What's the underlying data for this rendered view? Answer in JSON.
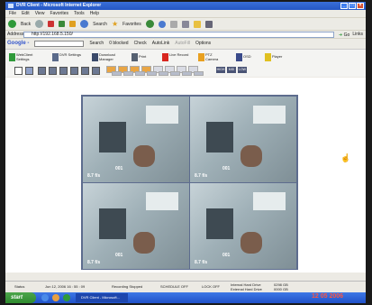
{
  "window": {
    "title": "DVR Client - Microsoft Internet Explorer",
    "controls": [
      "_",
      "□",
      "×"
    ]
  },
  "menu": [
    "File",
    "Edit",
    "View",
    "Favorites",
    "Tools",
    "Help"
  ],
  "ie_toolbar": {
    "back": "Back",
    "search": "Search",
    "favorites": "Favorites"
  },
  "address": {
    "label": "Address",
    "value": "http://192.168.5.150/",
    "go": "Go",
    "links": "Links"
  },
  "google_bar": {
    "logo": "Google -",
    "search": "Search",
    "blocked": "0 blocked",
    "check": "Check",
    "autolink": "AutoLink",
    "autofill": "AutoFill",
    "options": "Options"
  },
  "app_toolbar": [
    {
      "label": "WebClient Settings",
      "color": "#2f9a3a"
    },
    {
      "label": "DVR Settings",
      "color": "#5a6a8a"
    },
    {
      "label": "Download Manager",
      "color": "#3a4a6a"
    },
    {
      "label": "Print",
      "color": "#556070"
    },
    {
      "label": "Live Record",
      "color": "#d8261f"
    },
    {
      "label": "PTZ Camera",
      "color": "#e8a020"
    },
    {
      "label": "OSD",
      "color": "#3a4a8a"
    },
    {
      "label": "Player",
      "color": "#e0c020"
    }
  ],
  "layout_buttons": [
    "HIGH",
    "MID",
    "LOW"
  ],
  "cameras": [
    {
      "fps": "8.7 f/s",
      "channel": "001"
    },
    {
      "fps": "8.7 f/s",
      "channel": "001"
    },
    {
      "fps": "8.7 f/s",
      "channel": "001"
    },
    {
      "fps": "8.7 f/s",
      "channel": "001"
    }
  ],
  "status": {
    "status_label": "Status",
    "datetime": "Jun 12, 2006 16 : 55 : 09",
    "recording": "Recording Stopped",
    "schedule": "SCHEDULE OFF",
    "lock": "LOCK OFF",
    "internal_hdd_label": "Internal Hard Drive",
    "external_hdd_label": "External Hard Drive",
    "internal_hdd_value": "0298 GB",
    "external_hdd_value": "0000 GB"
  },
  "taskbar": {
    "start": "start",
    "task": "DVR Client - Microsoft...",
    "clock": "12 05 2006"
  }
}
